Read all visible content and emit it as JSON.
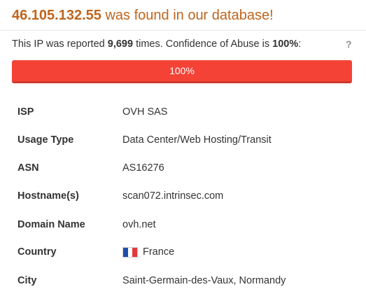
{
  "header": {
    "ip": "46.105.132.55",
    "found_text": " was found in our database!"
  },
  "report": {
    "prefix": "This IP was reported ",
    "count": "9,699",
    "middle": " times. Confidence of Abuse is ",
    "confidence": "100%",
    "suffix": ":",
    "help_label": "?"
  },
  "confidence_bar": {
    "label": "100%",
    "fraction": 1.0,
    "color": "#f44336"
  },
  "details": {
    "rows": [
      {
        "key": "ISP",
        "value": "OVH SAS"
      },
      {
        "key": "Usage Type",
        "value": "Data Center/Web Hosting/Transit"
      },
      {
        "key": "ASN",
        "value": "AS16276"
      },
      {
        "key": "Hostname(s)",
        "value": "scan072.intrinsec.com"
      },
      {
        "key": "Domain Name",
        "value": "ovh.net"
      },
      {
        "key": "Country",
        "value": "France",
        "icon": "france-flag-icon"
      },
      {
        "key": "City",
        "value": "Saint-Germain-des-Vaux, Normandy"
      }
    ]
  },
  "colors": {
    "headline": "#c0651d",
    "bar": "#f44336",
    "text": "#333333"
  }
}
